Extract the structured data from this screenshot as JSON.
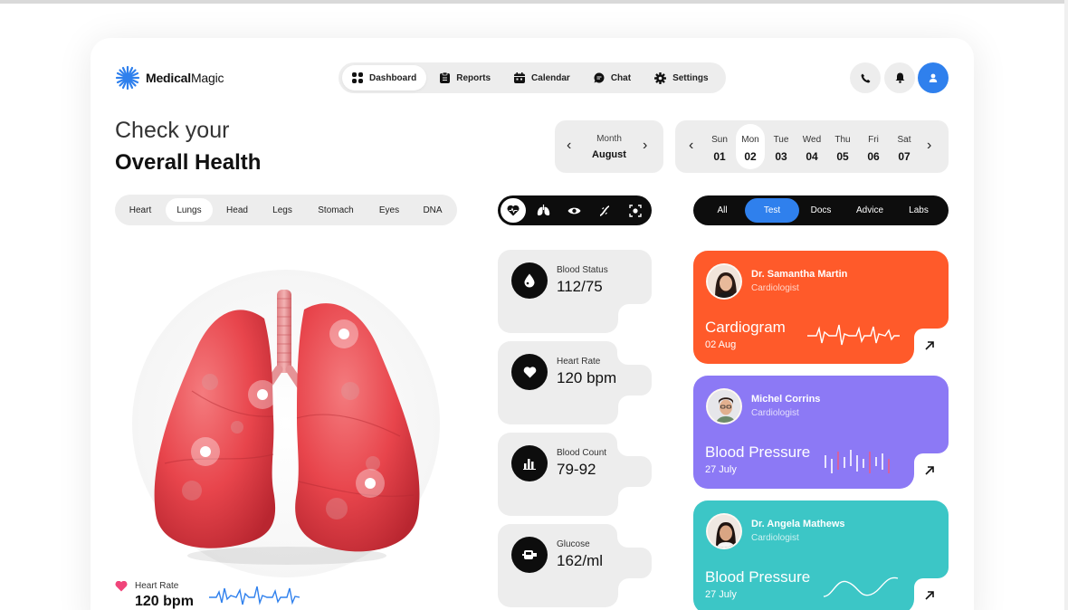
{
  "brand": {
    "name_bold": "Medical",
    "name_light": "Magic"
  },
  "nav": [
    {
      "label": "Dashboard",
      "icon": "grid-icon",
      "active": true
    },
    {
      "label": "Reports",
      "icon": "clipboard-icon"
    },
    {
      "label": "Calendar",
      "icon": "calendar-icon"
    },
    {
      "label": "Chat",
      "icon": "chat-icon"
    },
    {
      "label": "Settings",
      "icon": "gear-icon"
    }
  ],
  "header_buttons": [
    "phone-icon",
    "bell-icon",
    "user-icon"
  ],
  "heading": {
    "line1": "Check your",
    "line2": "Overall Health"
  },
  "month": {
    "label": "Month",
    "value": "August"
  },
  "days": [
    {
      "name": "Sun",
      "num": "01"
    },
    {
      "name": "Mon",
      "num": "02",
      "active": true
    },
    {
      "name": "Tue",
      "num": "03"
    },
    {
      "name": "Wed",
      "num": "04"
    },
    {
      "name": "Thu",
      "num": "05"
    },
    {
      "name": "Fri",
      "num": "06"
    },
    {
      "name": "Sat",
      "num": "07"
    }
  ],
  "organ_tabs": [
    "Heart",
    "Lungs",
    "Head",
    "Legs",
    "Stomach",
    "Eyes",
    "DNA"
  ],
  "organ_active": "Lungs",
  "icon_tabs": [
    "heart-monitor-icon",
    "lungs-icon",
    "eye-icon",
    "dna-icon",
    "scan-icon"
  ],
  "filter_tabs": [
    "All",
    "Test",
    "Docs",
    "Advice",
    "Labs"
  ],
  "filter_active": "Test",
  "heart_rate_footer": {
    "label": "Heart Rate",
    "value": "120 bpm"
  },
  "stats": [
    {
      "label": "Blood Status",
      "value": "112/75",
      "icon": "blood-drop-icon"
    },
    {
      "label": "Heart Rate",
      "value": "120 bpm",
      "icon": "heart-icon"
    },
    {
      "label": "Blood Count",
      "value": "79-92",
      "icon": "bar-chart-icon"
    },
    {
      "label": "Glucose",
      "value": "162/ml",
      "icon": "glucose-meter-icon"
    }
  ],
  "doctors": [
    {
      "name": "Dr. Samantha Martin",
      "role": "Cardiologist",
      "test": "Cardiogram",
      "date": "02 Aug",
      "color": "#ff5a2a"
    },
    {
      "name": "Michel Corrins",
      "role": "Cardiologist",
      "test": "Blood Pressure",
      "date": "27 July",
      "color": "#8c79f5"
    },
    {
      "name": "Dr. Angela Mathews",
      "role": "Cardiologist",
      "test": "Blood Pressure",
      "date": "27 July",
      "color": "#3cc6c6"
    }
  ],
  "colors": {
    "accent": "#2f80ed",
    "dark": "#0d0d0d",
    "panel": "#ededed",
    "lung": "#e8454c"
  }
}
